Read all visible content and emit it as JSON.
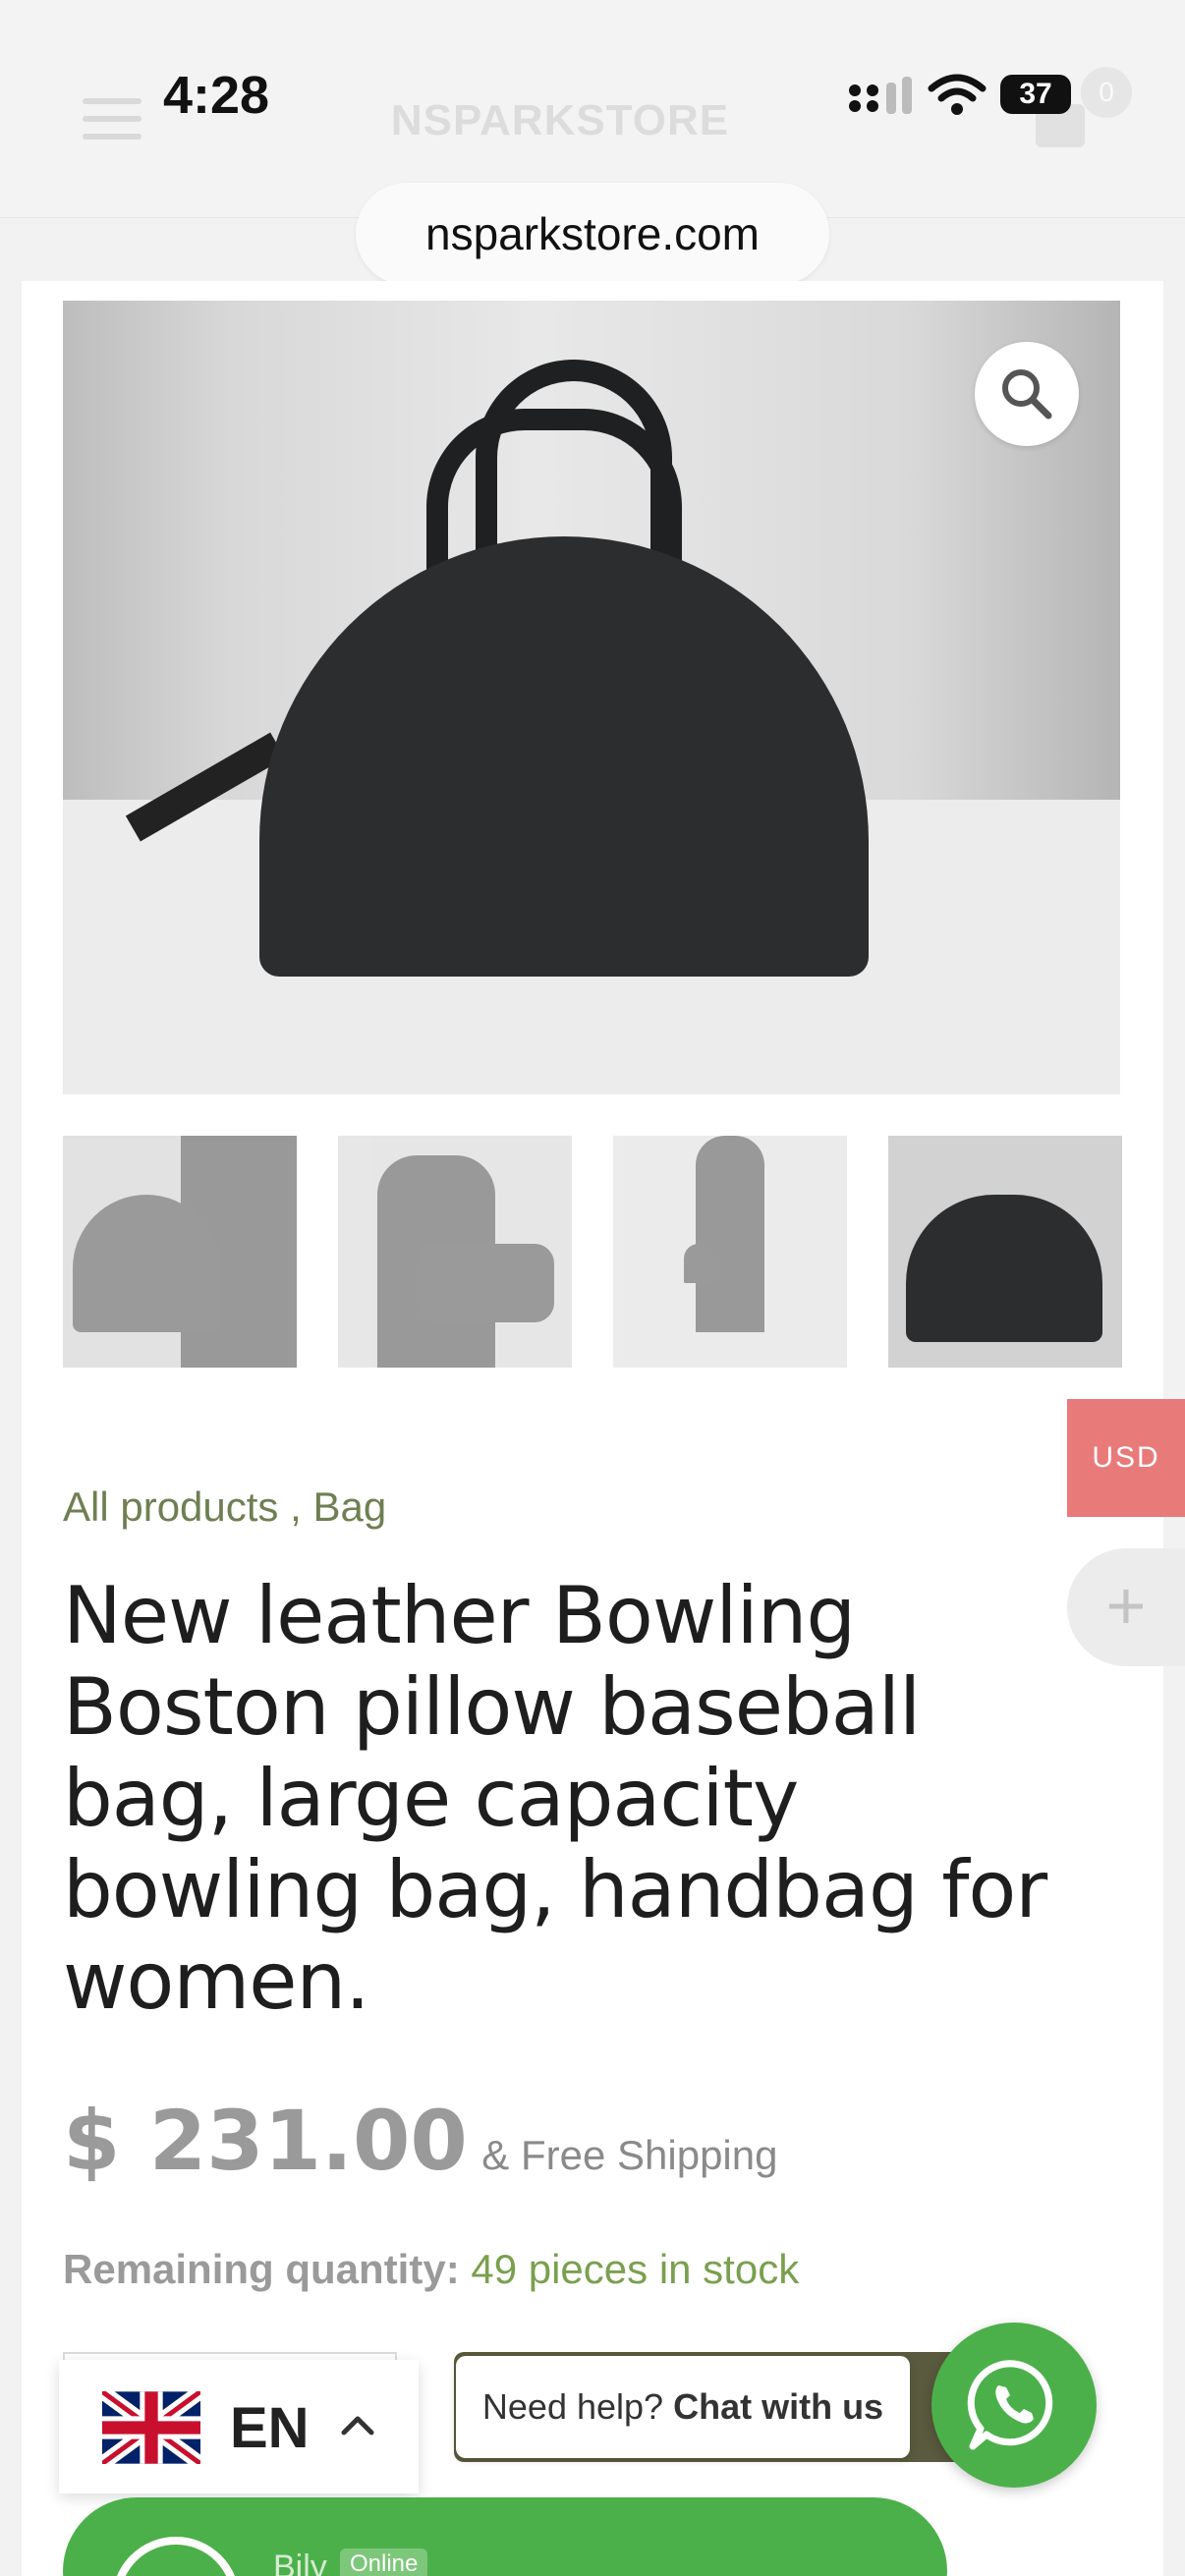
{
  "status_bar": {
    "time": "4:28",
    "battery": "37"
  },
  "header": {
    "brand": "NSPARKSTORE",
    "cart_count": "0"
  },
  "browser": {
    "url": "nsparkstore.com"
  },
  "product": {
    "breadcrumb": "All products , Bag",
    "title": "New leather Bowling Boston pillow baseball bag, large capacity bowling bag, handbag for women.",
    "price": "$ 231.00",
    "shipping": "& Free Shipping",
    "stock_label": "Remaining quantity:",
    "stock_value": "49 pieces in stock"
  },
  "widgets": {
    "currency": "USD",
    "plus": "+",
    "language": "EN",
    "help_text": "Need help?",
    "help_link": "Chat with us",
    "agent_name": "Bily",
    "agent_status": "Online"
  },
  "colors": {
    "accent_green": "#4cb04a",
    "currency_tab": "#e87a7a",
    "breadcrumb": "#6f7f52",
    "stock_green": "#7aa04f"
  }
}
